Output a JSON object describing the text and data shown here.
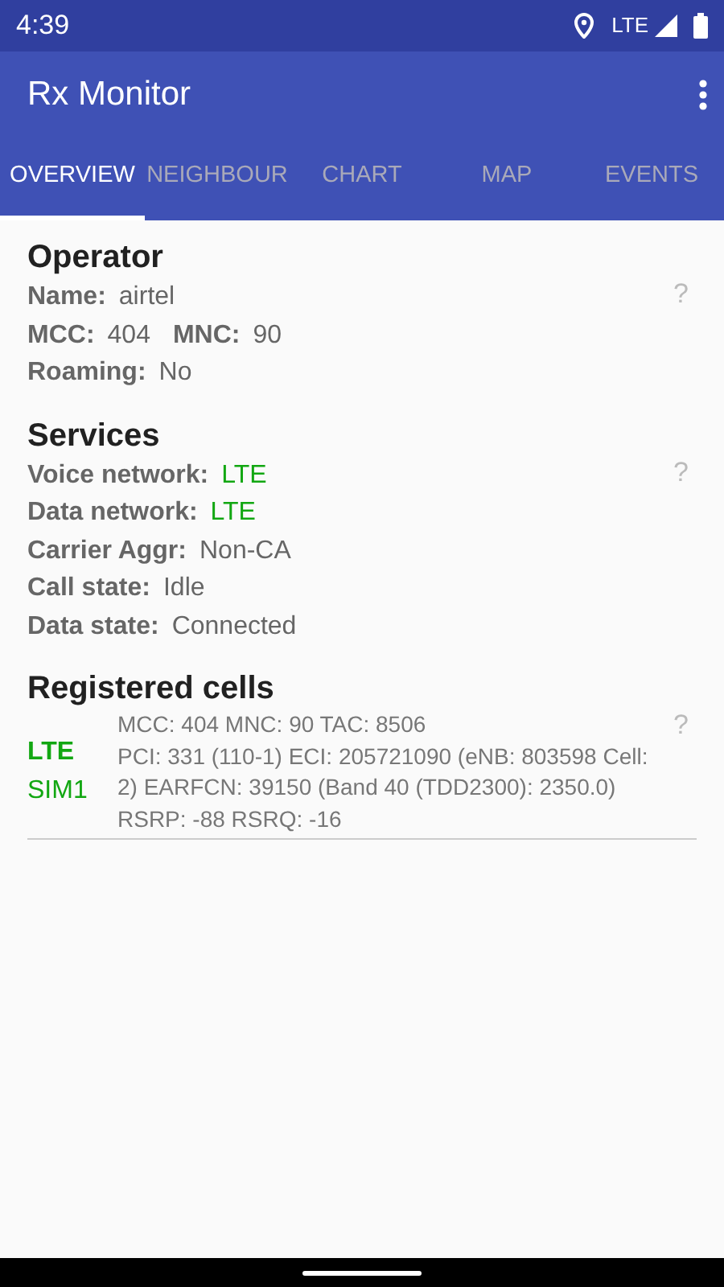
{
  "status_bar": {
    "time": "4:39",
    "network": "LTE"
  },
  "app_bar": {
    "title": "Rx Monitor"
  },
  "tabs": [
    {
      "label": "OVERVIEW",
      "selected": true
    },
    {
      "label": "NEIGHBOUR",
      "selected": false
    },
    {
      "label": "CHART",
      "selected": false
    },
    {
      "label": "MAP",
      "selected": false
    },
    {
      "label": "EVENTS",
      "selected": false
    }
  ],
  "sections": [
    {
      "title": "Operator",
      "help": "?",
      "rows": [
        [
          {
            "label": "Name:",
            "value": "airtel",
            "color": "#666666"
          }
        ],
        [
          {
            "label": "MCC:",
            "value": "404",
            "color": "#666666"
          },
          {
            "label": "MNC:",
            "value": "90",
            "color": "#666666"
          }
        ],
        [
          {
            "label": "Roaming:",
            "value": "No",
            "color": "#666666"
          }
        ]
      ]
    },
    {
      "title": "Services",
      "help": "?",
      "rows": [
        [
          {
            "label": "Voice network:",
            "value": "LTE",
            "color": "#12a712"
          }
        ],
        [
          {
            "label": "Data network:",
            "value": "LTE",
            "color": "#12a712"
          }
        ],
        [
          {
            "label": "Carrier Aggr:",
            "value": "Non-CA",
            "color": "#666666"
          }
        ],
        [
          {
            "label": "Call state:",
            "value": "Idle",
            "color": "#666666"
          }
        ],
        [
          {
            "label": "Data state:",
            "value": "Connected",
            "color": "#666666"
          }
        ]
      ]
    }
  ],
  "registered_cells": {
    "title": "Registered cells",
    "cells": [
      {
        "rat": "LTE",
        "sim": "SIM1",
        "help": "?",
        "lines": [
          "MCC: 404  MNC: 90  TAC: 8506",
          "PCI: 331 (110-1)  ECI: 205721090 (eNB: 803598 Cell: 2)  EARFCN: 39150 (Band 40 (TDD2300): 2350.0)",
          "RSRP: -88  RSRQ: -16"
        ]
      }
    ]
  }
}
